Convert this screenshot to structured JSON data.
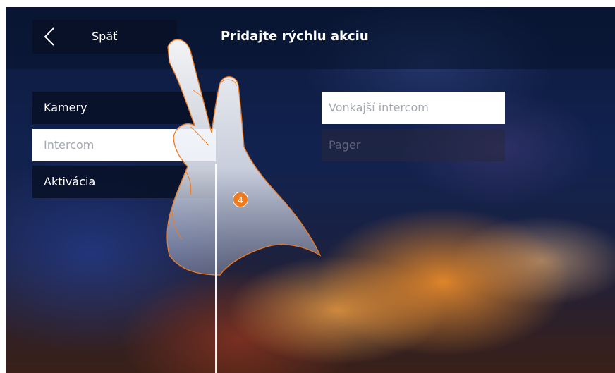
{
  "header": {
    "back_label": "Späť",
    "title": "Pridajte rýchlu akciu"
  },
  "menu": {
    "items": [
      {
        "label": "Kamery",
        "state": "normal"
      },
      {
        "label": "Intercom",
        "state": "selected"
      },
      {
        "label": "Aktivácia",
        "state": "normal"
      }
    ]
  },
  "options": {
    "items": [
      {
        "label": "Vonkajší intercom",
        "state": "active"
      },
      {
        "label": "Pager",
        "state": "disabled"
      }
    ]
  },
  "annotation": {
    "step_number": "4"
  },
  "colors": {
    "accent_orange": "#f07a1e",
    "panel_dark": "#081026",
    "selected_bg": "#ffffff",
    "selected_text": "#a4a9b2"
  },
  "icons": {
    "back": "chevron-left-icon",
    "pointer": "hand-pointer-icon"
  }
}
